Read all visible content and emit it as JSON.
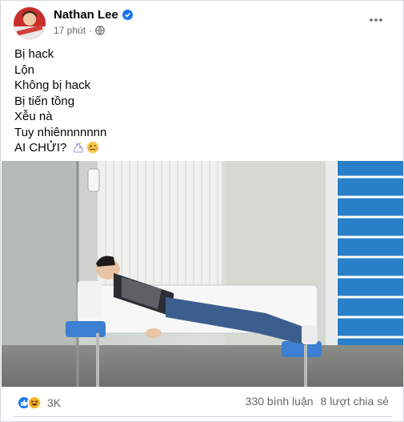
{
  "post": {
    "author": "Nathan Lee",
    "time": "17 phút",
    "lines": [
      "Bị hack",
      "Lộn",
      "Không bị hack",
      "Bị tiến tồng",
      "Xễu nà",
      "Tuy nhiênnnnnnn",
      "AI CHỬI?"
    ]
  },
  "footer": {
    "reaction_count": "3K",
    "comments": "330 bình luận",
    "shares": "8 lượt chia sẻ"
  },
  "colors": {
    "brand_blue": "#1877f2",
    "secondary_text": "#65676b",
    "haha_yellow": "#f7b125"
  },
  "icons": {
    "verified": "verified-badge-icon",
    "privacy": "globe-icon",
    "more": "more-options-icon",
    "like": "like-reaction-icon",
    "haha": "haha-reaction-icon"
  }
}
